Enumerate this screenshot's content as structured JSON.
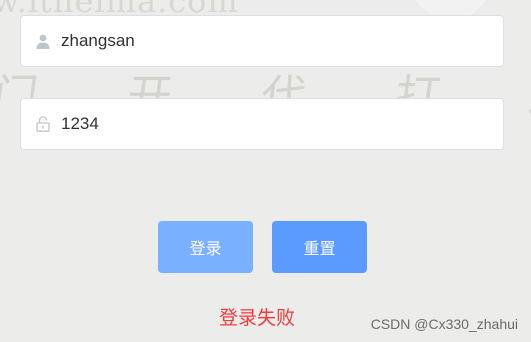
{
  "background": {
    "watermark_url": "w.itheima.com",
    "watermark_calligraphy": "门 开 代 打 进 黑 马 北 最",
    "color": "#ececea"
  },
  "form": {
    "username": {
      "value": "zhangsan",
      "icon": "user-icon"
    },
    "password": {
      "value": "1234",
      "icon": "lock-icon"
    }
  },
  "buttons": {
    "login_label": "登录",
    "reset_label": "重置",
    "login_color": "#79b0ff",
    "reset_color": "#5b9bff"
  },
  "status": {
    "error_text": "登录失败",
    "error_color": "#f23b3b"
  },
  "credit": "CSDN @Cx330_zhahui"
}
